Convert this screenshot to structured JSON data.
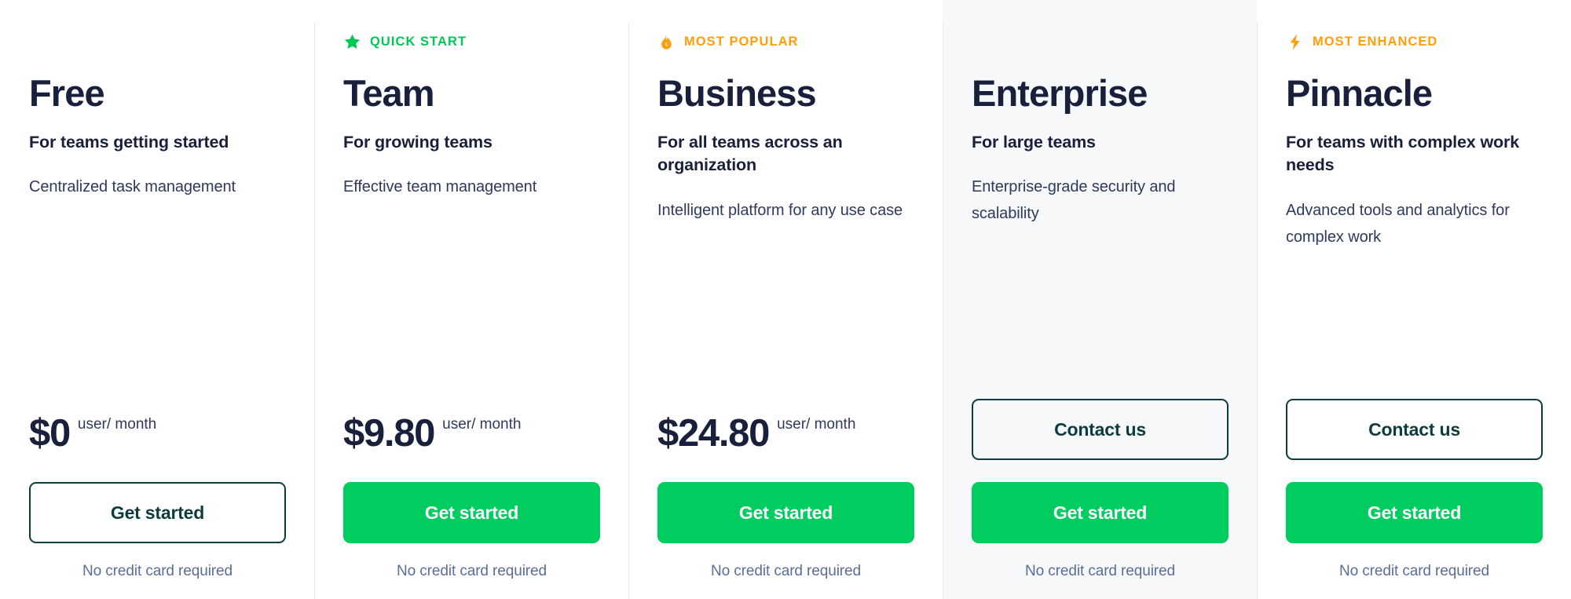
{
  "accent": {
    "green": "#00cc5f",
    "badge_green": "#00c853",
    "orange": "#ff9e0b",
    "navy": "#18203c",
    "outline": "#0d3b3f",
    "muted": "#5b6e95",
    "shaded_bg": "#f6f8fa"
  },
  "columns": [
    {
      "id": "free",
      "badge": {
        "label": "",
        "icon": "",
        "color": ""
      },
      "name": "Free",
      "tagline": "For teams getting started",
      "description": "Centralized task management",
      "price": "$0",
      "price_unit": "user/ month",
      "has_price": true,
      "contact_label": "",
      "cta_label": "Get started",
      "cta_style": "outline",
      "footnote": "No credit card required",
      "shaded": false
    },
    {
      "id": "team",
      "badge": {
        "label": "QUICK START",
        "icon": "star-icon",
        "color": "green"
      },
      "name": "Team",
      "tagline": "For growing teams",
      "description": "Effective team management",
      "price": "$9.80",
      "price_unit": "user/ month",
      "has_price": true,
      "contact_label": "",
      "cta_label": "Get started",
      "cta_style": "solid",
      "footnote": "No credit card required",
      "shaded": false
    },
    {
      "id": "business",
      "badge": {
        "label": "MOST POPULAR",
        "icon": "flame-icon",
        "color": "orange"
      },
      "name": "Business",
      "tagline": "For all teams across an organization",
      "description": "Intelligent platform for any use case",
      "price": "$24.80",
      "price_unit": "user/ month",
      "has_price": true,
      "contact_label": "",
      "cta_label": "Get started",
      "cta_style": "solid",
      "footnote": "No credit card required",
      "shaded": false
    },
    {
      "id": "enterprise",
      "badge": {
        "label": "",
        "icon": "",
        "color": ""
      },
      "name": "Enterprise",
      "tagline": "For large teams",
      "description": "Enterprise-grade security and scalability",
      "price": "",
      "price_unit": "",
      "has_price": false,
      "contact_label": "Contact us",
      "cta_label": "Get started",
      "cta_style": "solid",
      "footnote": "No credit card required",
      "shaded": true
    },
    {
      "id": "pinnacle",
      "badge": {
        "label": "MOST ENHANCED",
        "icon": "bolt-icon",
        "color": "orange"
      },
      "name": "Pinnacle",
      "tagline": "For teams with complex work needs",
      "description": "Advanced tools and analytics for complex work",
      "price": "",
      "price_unit": "",
      "has_price": false,
      "contact_label": "Contact us",
      "cta_label": "Get started",
      "cta_style": "solid",
      "footnote": "No credit card required",
      "shaded": false
    }
  ]
}
